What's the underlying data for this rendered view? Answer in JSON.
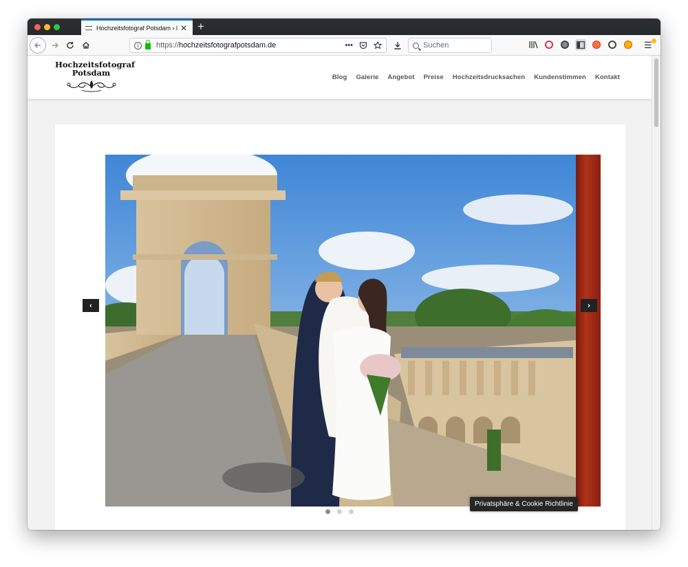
{
  "browser": {
    "tab_title": "Hochzeitsfotograf Potsdam › le",
    "tab_close": "✕",
    "new_tab": "+",
    "url_prefix": "https://",
    "url_host": "hochzeitsfotografpotsdam.de",
    "search_placeholder": "Suchen",
    "url_more": "•••"
  },
  "site": {
    "logo_line1": "Hochzeitsfotograf",
    "logo_line2": "Potsdam",
    "nav": [
      "Blog",
      "Galerie",
      "Angebot",
      "Preise",
      "Hochzeitsdrucksachen",
      "Kundenstimmen",
      "Kontakt"
    ]
  },
  "slider": {
    "prev": "‹",
    "next": "›",
    "dots": 3,
    "active_dot": 0
  },
  "cookie_banner": "Privatsphäre & Cookie Richtlinie"
}
